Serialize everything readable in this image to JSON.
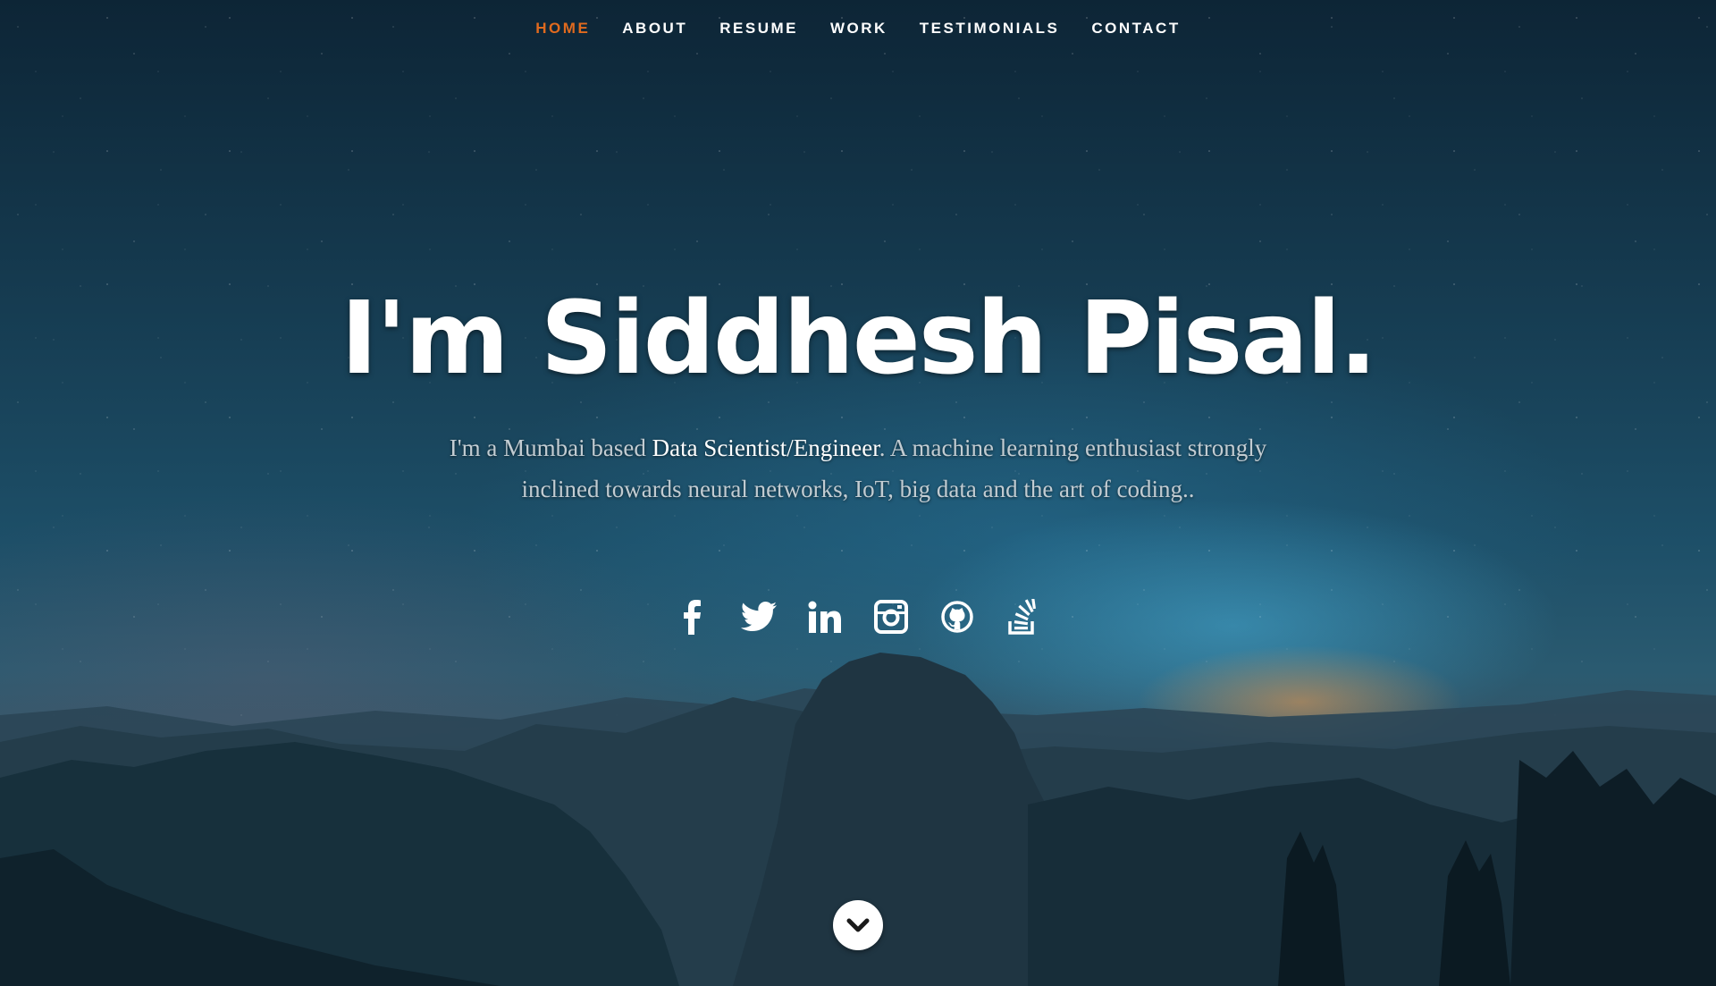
{
  "nav": {
    "items": [
      {
        "label": "HOME",
        "active": true
      },
      {
        "label": "ABOUT",
        "active": false
      },
      {
        "label": "RESUME",
        "active": false
      },
      {
        "label": "WORK",
        "active": false
      },
      {
        "label": "TESTIMONIALS",
        "active": false
      },
      {
        "label": "CONTACT",
        "active": false
      }
    ]
  },
  "hero": {
    "headline": "I'm Siddhesh Pisal.",
    "intro_before": "I'm a Mumbai based ",
    "intro_highlight": "Data Scientist/Engineer",
    "intro_after": ". A machine learning enthusiast strongly inclined towards neural networks, IoT, big data and the art of coding.."
  },
  "socials": [
    {
      "icon": "facebook-icon"
    },
    {
      "icon": "twitter-icon"
    },
    {
      "icon": "linkedin-icon"
    },
    {
      "icon": "instagram-icon"
    },
    {
      "icon": "github-icon"
    },
    {
      "icon": "stackoverflow-icon"
    }
  ],
  "scroll": {
    "icon": "chevron-down-icon"
  },
  "colors": {
    "accent": "#e06a1e",
    "text": "#ffffff",
    "muted_text": "#c2ccd2"
  }
}
